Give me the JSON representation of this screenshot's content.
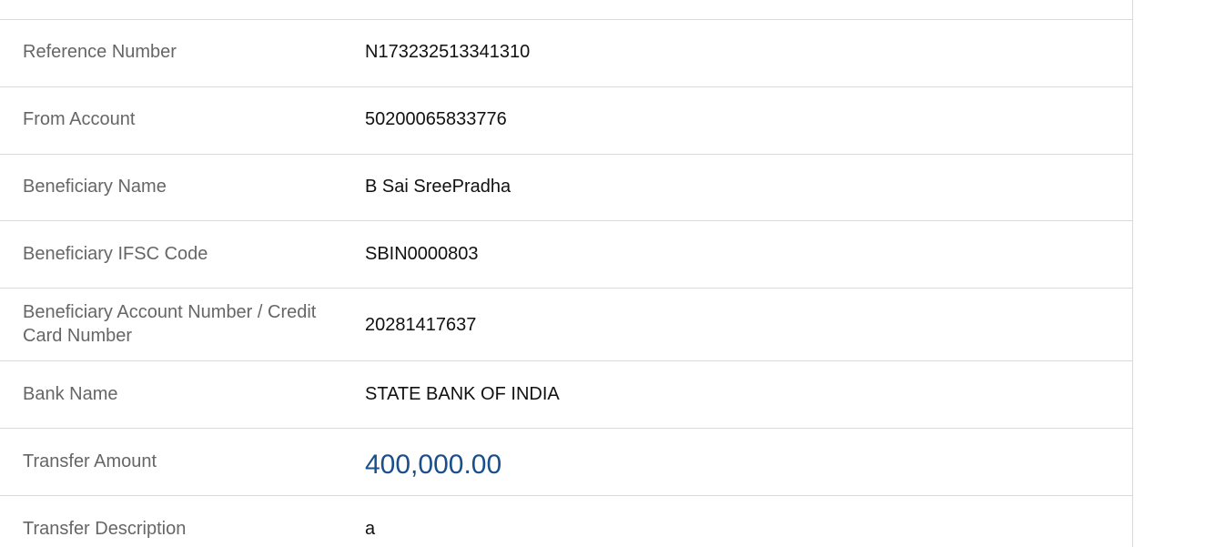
{
  "transfer_details": {
    "rows": [
      {
        "label": "Reference Number",
        "value": "N173232513341310"
      },
      {
        "label": "From Account",
        "value": "50200065833776"
      },
      {
        "label": "Beneficiary Name",
        "value": "B Sai SreePradha"
      },
      {
        "label": "Beneficiary IFSC Code",
        "value": "SBIN0000803"
      },
      {
        "label": "Beneficiary Account Number / Credit Card Number",
        "value": "20281417637"
      },
      {
        "label": "Bank Name",
        "value": "STATE BANK OF INDIA"
      },
      {
        "label": "Transfer Amount",
        "value": "400,000.00"
      },
      {
        "label": "Transfer Description",
        "value": "a"
      }
    ]
  },
  "colors": {
    "label": "#666666",
    "value": "#111111",
    "amount": "#1a4f8b",
    "divider": "#d9d9d9"
  }
}
